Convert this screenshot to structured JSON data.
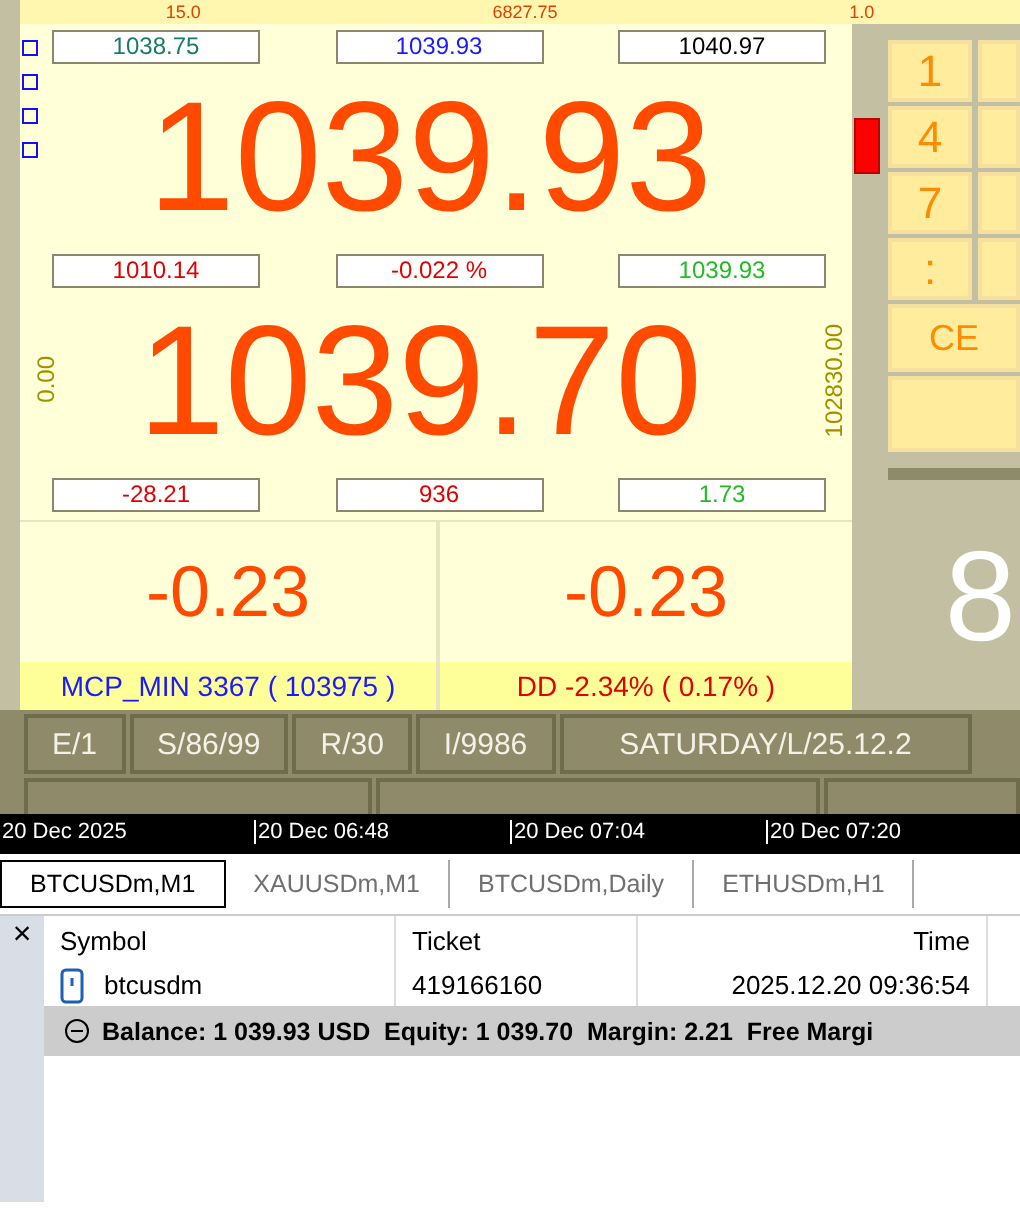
{
  "top_strip": [
    "15.0",
    "6827.75",
    "1.0"
  ],
  "panel": {
    "upper_boxes": [
      {
        "text": "1038.75",
        "color": "#1a7a6a"
      },
      {
        "text": "1039.93",
        "color": "#1a1aff"
      },
      {
        "text": "1040.97",
        "color": "#000000"
      }
    ],
    "main_price": "1039.93",
    "middle_boxes": [
      {
        "text": "1010.14",
        "color": "#e00000"
      },
      {
        "text": "-0.022 %",
        "color": "#e00000"
      },
      {
        "text": "1039.93",
        "color": "#22bb22"
      }
    ],
    "second_price": "1039.70",
    "left_axis": "0.00",
    "right_axis": "102830.00",
    "lower_boxes": [
      {
        "text": "-28.21",
        "color": "#e00000"
      },
      {
        "text": "936",
        "color": "#e00000"
      },
      {
        "text": "1.73",
        "color": "#22bb22"
      }
    ],
    "profits": [
      {
        "value": "-0.23",
        "caption": "MCP_MIN 3367 ( 103975 )",
        "color": "#1a1aff"
      },
      {
        "value": "-0.23",
        "caption": "DD -2.34% ( 0.17% )",
        "color": "#e00000"
      }
    ]
  },
  "keypad": {
    "keys": [
      "1",
      "4",
      "7",
      ":"
    ],
    "clear": "CE",
    "display": "8"
  },
  "status_buttons": [
    "E/1",
    "S/86/99",
    "R/30",
    "I/9986",
    "SATURDAY/L/25.12.2"
  ],
  "time_axis": [
    "20 Dec 2025",
    "20 Dec 06:48",
    "20 Dec 07:04",
    "20 Dec 07:20"
  ],
  "chart_tabs": [
    {
      "label": "BTCUSDm,M1",
      "selected": true
    },
    {
      "label": "XAUUSDm,M1",
      "selected": false
    },
    {
      "label": "BTCUSDm,Daily",
      "selected": false
    },
    {
      "label": "ETHUSDm,H1",
      "selected": false
    }
  ],
  "close": "×",
  "table": {
    "columns": [
      "Symbol",
      "Ticket",
      "Time"
    ],
    "rows": [
      {
        "symbol": "btcusdm",
        "ticket": "419166160",
        "time": "2025.12.20 09:36:54"
      }
    ],
    "summary": "Balance: 1 039.93 USD  Equity: 1 039.70  Margin: 2.21  Free Margi"
  }
}
